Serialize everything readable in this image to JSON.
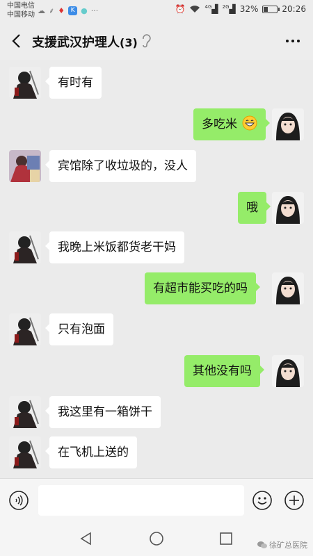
{
  "status_bar": {
    "carrier_1": "中国电信",
    "carrier_2": "中国移动",
    "network_1": "4G",
    "network_2": "2G",
    "battery": "32%",
    "battery_level": 0.32,
    "time": "20:26",
    "icons": [
      "cloud-icon",
      "notification-icon",
      "map-pin-icon",
      "app-k-icon",
      "dot-icon",
      "more-dots-icon",
      "alarm-icon",
      "wifi-icon",
      "signal-icon",
      "battery-icon"
    ]
  },
  "header": {
    "title": "支援武汉护理人",
    "member_count": "(3)",
    "icons": [
      "back-arrow-icon",
      "ear-icon",
      "more-icon"
    ]
  },
  "messages": [
    {
      "side": "in",
      "text": "有时有"
    },
    {
      "side": "out",
      "text": "多吃米",
      "emoji": "grinning-face-icon"
    },
    {
      "side": "in",
      "text": "宾馆除了收垃圾的，没人"
    },
    {
      "side": "out",
      "text": "哦"
    },
    {
      "side": "in",
      "text": "我晚上米饭都货老干妈"
    },
    {
      "side": "out",
      "text": "有超市能买吃的吗"
    },
    {
      "side": "in",
      "text": "只有泡面"
    },
    {
      "side": "out",
      "text": "其他没有吗"
    },
    {
      "side": "in",
      "text": "我这里有一箱饼干"
    },
    {
      "side": "in",
      "text": "在飞机上送的"
    }
  ],
  "input_bar": {
    "value": "",
    "icons": [
      "voice-icon",
      "emoji-icon",
      "plus-icon"
    ]
  },
  "watermark": "徐矿总医院",
  "colors": {
    "out_bubble": "#95ec69",
    "in_bubble": "#ffffff",
    "chat_bg": "#ebebeb"
  }
}
